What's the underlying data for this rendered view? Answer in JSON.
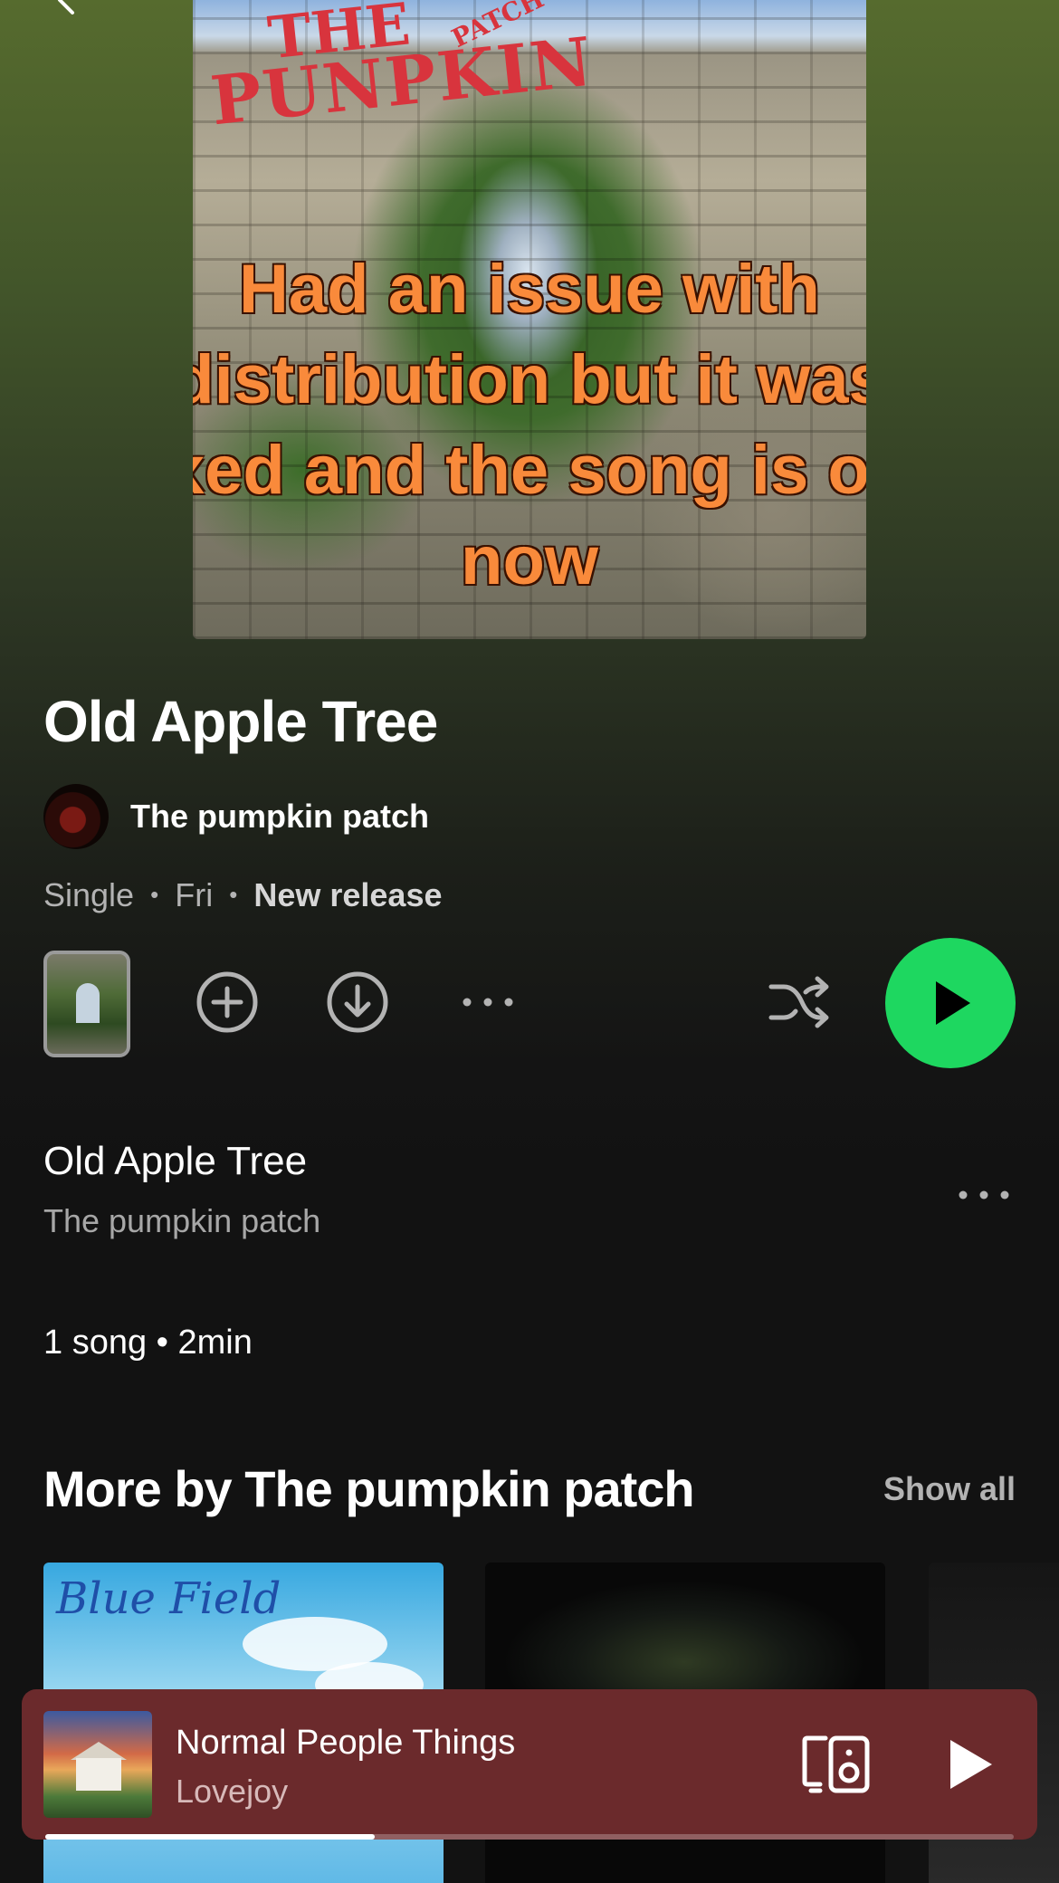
{
  "icons": {
    "back": "chevron-left-icon",
    "add": "add-circle-icon",
    "download": "download-circle-icon",
    "more": "more-horizontal-icon",
    "shuffle": "shuffle-icon",
    "play": "play-icon",
    "devices": "connect-device-icon"
  },
  "colors": {
    "accent_green": "#1ed760",
    "mini_player_bg": "#6b2a2c",
    "background": "#121212"
  },
  "cover": {
    "logo_line1": "THE",
    "logo_line2": "PUNPKIN",
    "logo_line3": "PATCH",
    "caption": "Had an issue with distribution but it was fixed and the song is out now"
  },
  "release": {
    "title": "Old Apple Tree",
    "artist": "The pumpkin patch",
    "type": "Single",
    "date": "Fri",
    "badge": "New release",
    "separator": "•"
  },
  "tracks": [
    {
      "title": "Old Apple Tree",
      "artist": "The pumpkin patch"
    }
  ],
  "summary": "1 song • 2min",
  "more_by": {
    "heading": "More by The pumpkin patch",
    "show_all": "Show all",
    "albums": [
      {
        "art_text": "Blue Field"
      },
      {
        "art_text": ""
      },
      {
        "art_text": ""
      }
    ]
  },
  "now_playing": {
    "title": "Normal People Things",
    "artist": "Lovejoy",
    "progress": 0.34
  }
}
